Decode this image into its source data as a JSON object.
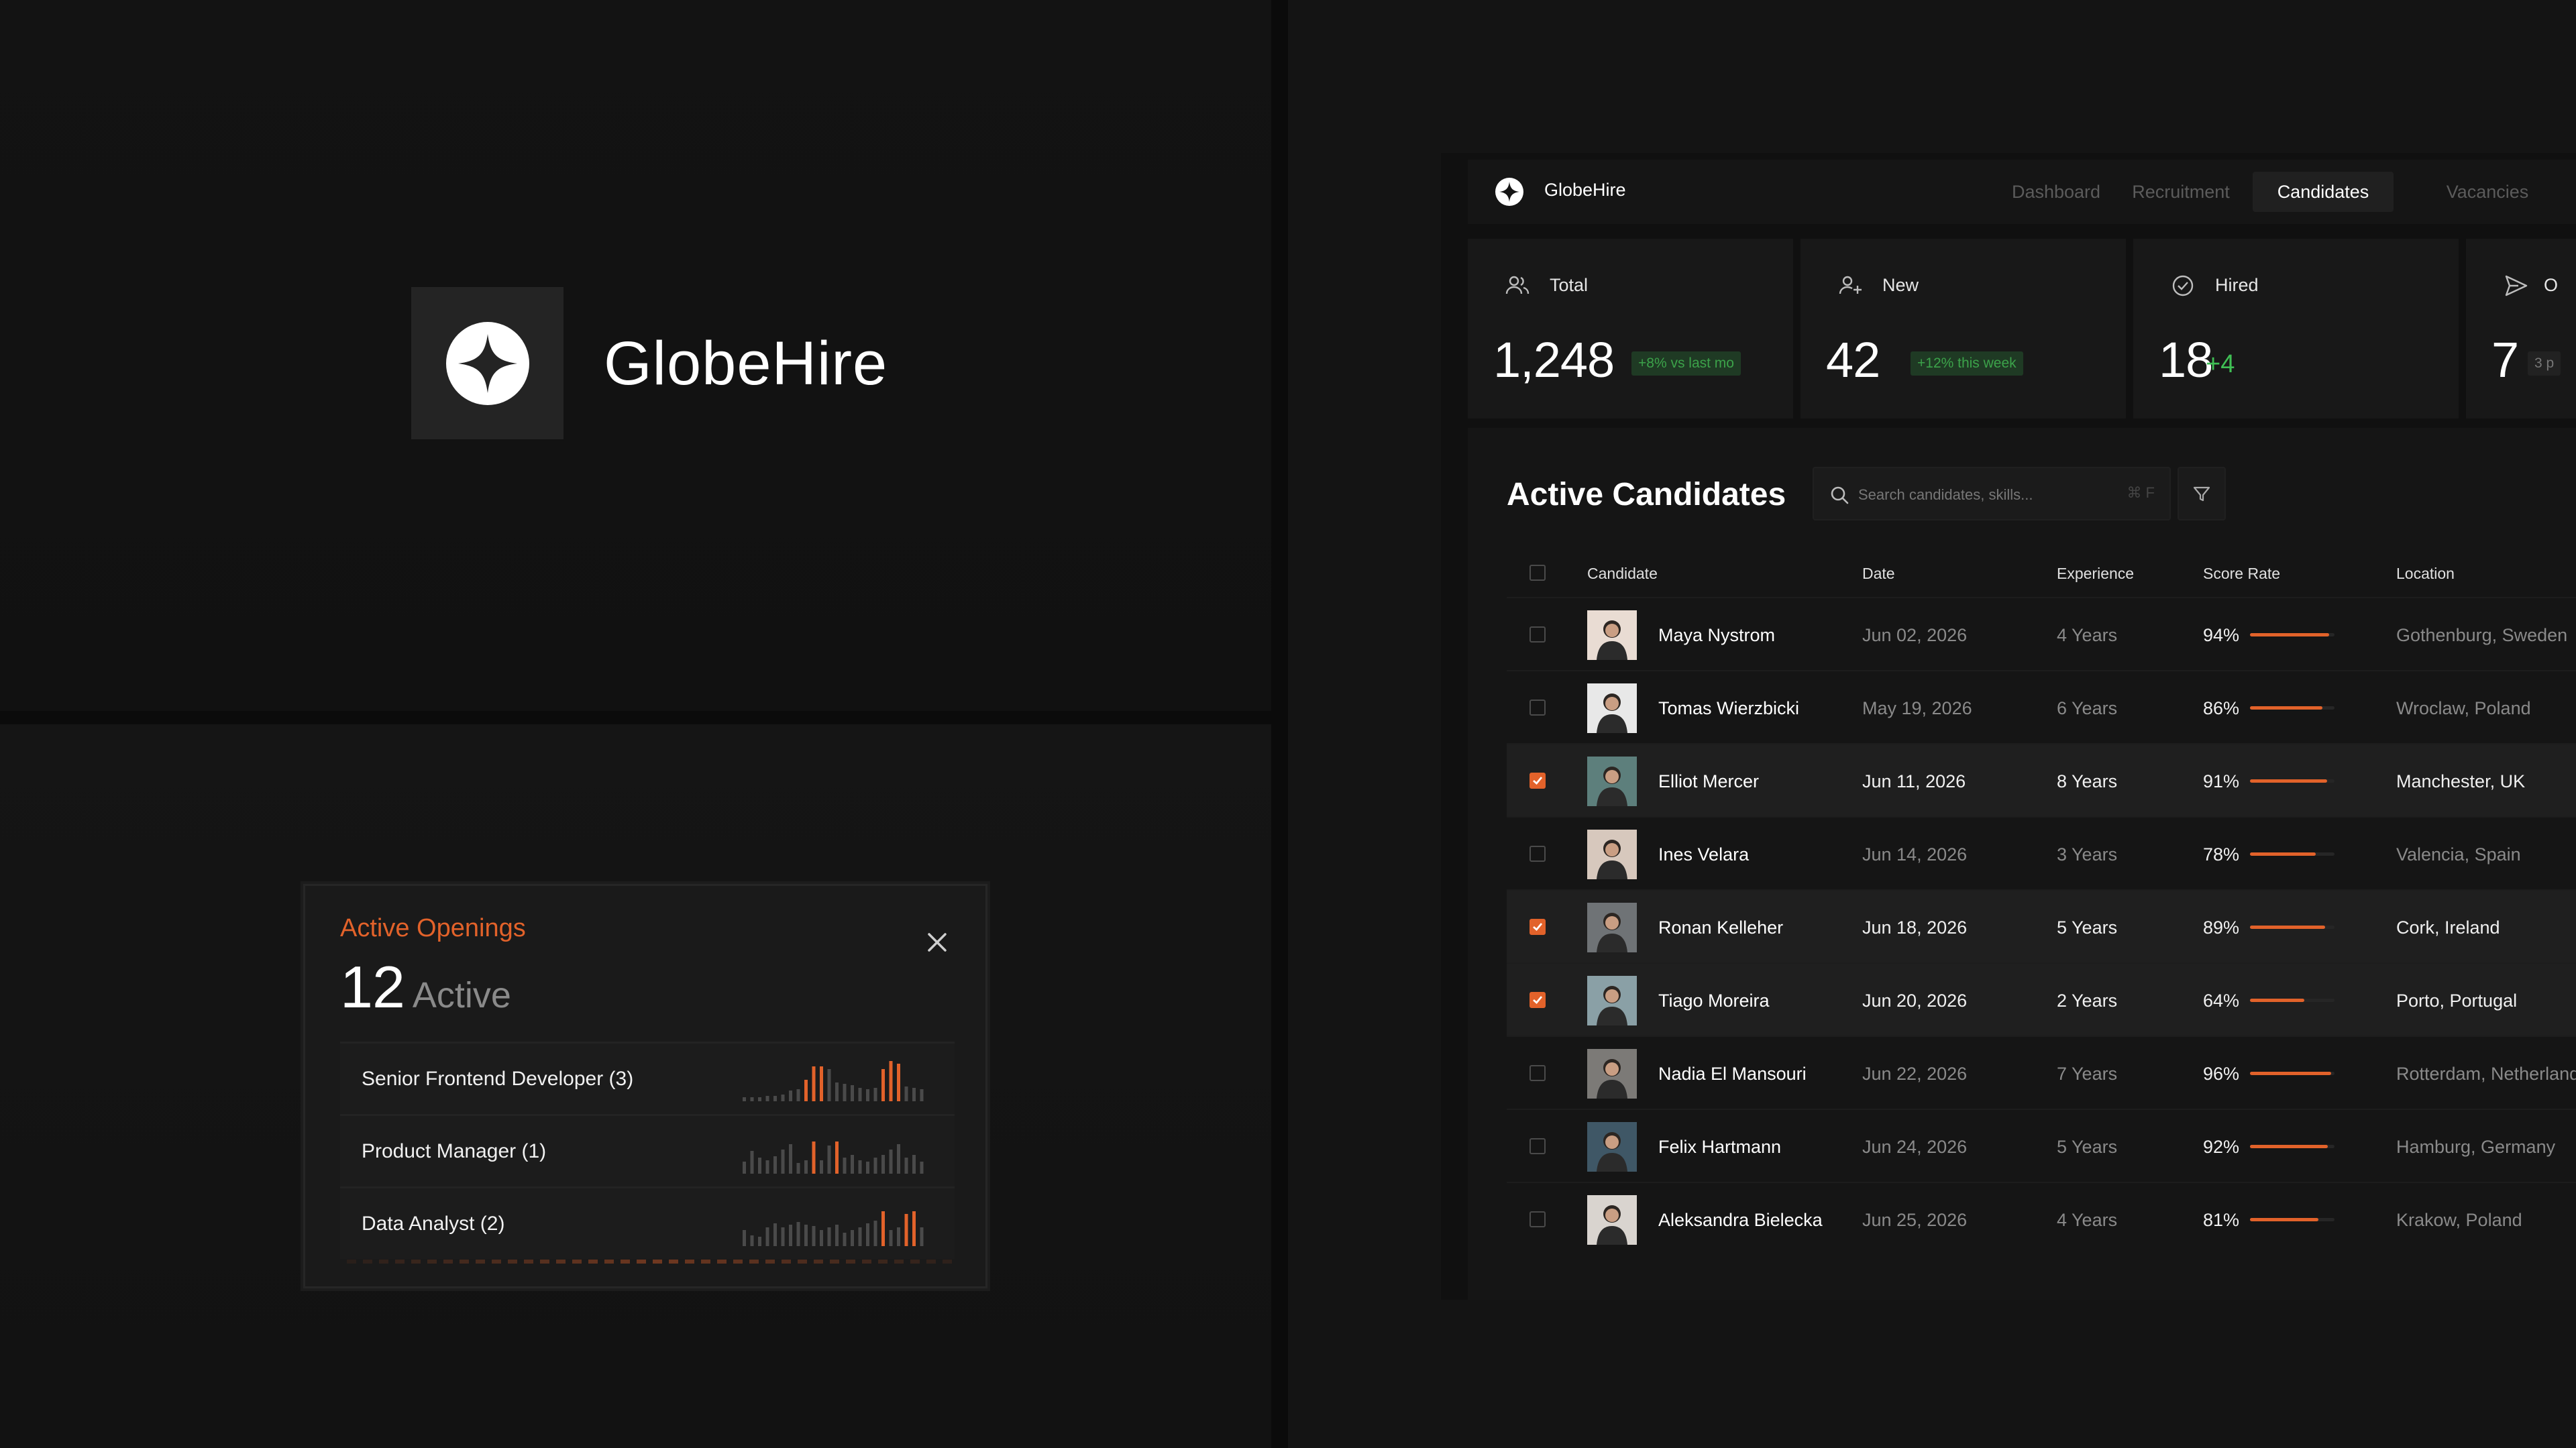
{
  "brand": {
    "name": "GlobeHire"
  },
  "colors": {
    "accent": "#e2622a",
    "positive": "#3fbf54",
    "background": "#141414"
  },
  "openings": {
    "title": "Active Openings",
    "count": "12",
    "count_label": "Active",
    "close_icon": "close-icon",
    "items": [
      {
        "label": "Senior Frontend Developer (3)"
      },
      {
        "label": "Product Manager (1)"
      },
      {
        "label": "Data Analyst (2)"
      }
    ]
  },
  "nav": {
    "items": [
      {
        "label": "Dashboard",
        "active": false
      },
      {
        "label": "Recruitment",
        "active": false
      },
      {
        "label": "Candidates",
        "active": true
      },
      {
        "label": "Vacancies",
        "active": false
      }
    ]
  },
  "stats": [
    {
      "label": "Total",
      "value": "1,248",
      "delta": "+8% vs last mo",
      "icon": "users-icon"
    },
    {
      "label": "New",
      "value": "42",
      "delta": "+12% this week",
      "icon": "user-plus-icon"
    },
    {
      "label": "Hired",
      "value": "18",
      "delta": "+4",
      "icon": "check-circle-icon"
    },
    {
      "label": "O",
      "value": "7",
      "delta": "3 p",
      "icon": "send-icon"
    }
  ],
  "candidates": {
    "title": "Active Candidates",
    "search_placeholder": "Search candidates, skills...",
    "search_shortcut": "⌘ F",
    "columns": [
      "Candidate",
      "Date",
      "Experience",
      "Score Rate",
      "Location"
    ],
    "rows": [
      {
        "name": "Maya Nystrom",
        "date": "Jun 02, 2026",
        "experience": "4 Years",
        "score": "94%",
        "score_value": 94,
        "location": "Gothenburg, Sweden",
        "selected": false
      },
      {
        "name": "Tomas Wierzbicki",
        "date": "May 19, 2026",
        "experience": "6 Years",
        "score": "86%",
        "score_value": 86,
        "location": "Wroclaw, Poland",
        "selected": false
      },
      {
        "name": "Elliot Mercer",
        "date": "Jun 11, 2026",
        "experience": "8 Years",
        "score": "91%",
        "score_value": 91,
        "location": "Manchester, UK",
        "selected": true
      },
      {
        "name": "Ines Velara",
        "date": "Jun 14, 2026",
        "experience": "3 Years",
        "score": "78%",
        "score_value": 78,
        "location": "Valencia, Spain",
        "selected": false
      },
      {
        "name": "Ronan Kelleher",
        "date": "Jun 18, 2026",
        "experience": "5 Years",
        "score": "89%",
        "score_value": 89,
        "location": "Cork, Ireland",
        "selected": true
      },
      {
        "name": "Tiago Moreira",
        "date": "Jun 20, 2026",
        "experience": "2 Years",
        "score": "64%",
        "score_value": 64,
        "location": "Porto, Portugal",
        "selected": true
      },
      {
        "name": "Nadia El Mansouri",
        "date": "Jun 22, 2026",
        "experience": "7 Years",
        "score": "96%",
        "score_value": 96,
        "location": "Rotterdam, Netherlands",
        "selected": false
      },
      {
        "name": "Felix Hartmann",
        "date": "Jun 24, 2026",
        "experience": "5 Years",
        "score": "92%",
        "score_value": 92,
        "location": "Hamburg, Germany",
        "selected": false
      },
      {
        "name": "Aleksandra Bielecka",
        "date": "Jun 25, 2026",
        "experience": "4 Years",
        "score": "81%",
        "score_value": 81,
        "location": "Krakow, Poland",
        "selected": false
      }
    ]
  }
}
